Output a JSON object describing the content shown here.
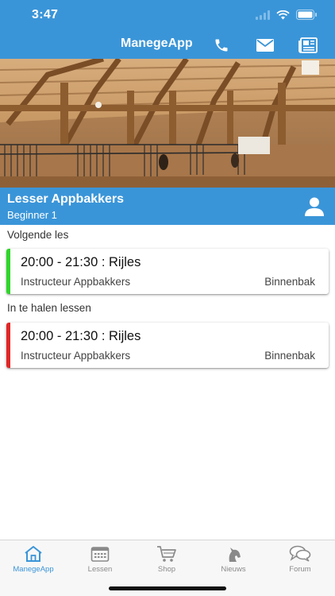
{
  "status": {
    "time": "3:47"
  },
  "navbar": {
    "title": "ManegeApp",
    "icons": [
      "phone-icon",
      "mail-icon",
      "newspaper-icon"
    ]
  },
  "hero": {
    "alt": "photo-of-riding-arena"
  },
  "profile": {
    "name": "Lesser Appbakkers",
    "level": "Beginner 1",
    "icon": "user-icon"
  },
  "next_lesson": {
    "label": "Volgende les",
    "title": "20:00 - 21:30 : Rijles",
    "instructor": "Instructeur Appbakkers",
    "location": "Binnenbak",
    "status_color": "#2fd52a"
  },
  "makeup_lessons": {
    "label": "In te halen lessen",
    "items": [
      {
        "title": "20:00 - 21:30 : Rijles",
        "instructor": "Instructeur Appbakkers",
        "location": "Binnenbak",
        "status_color": "#e02626"
      }
    ]
  },
  "tabbar": {
    "tabs": [
      {
        "label": "ManegeApp",
        "icon": "home-icon",
        "active": true
      },
      {
        "label": "Lessen",
        "icon": "calendar-icon",
        "active": false
      },
      {
        "label": "Shop",
        "icon": "cart-icon",
        "active": false
      },
      {
        "label": "Nieuws",
        "icon": "horse-icon",
        "active": false
      },
      {
        "label": "Forum",
        "icon": "chat-bubbles-icon",
        "active": false
      }
    ]
  },
  "colors": {
    "primary": "#3a95d8",
    "tab_inactive": "#8a8a8a"
  }
}
